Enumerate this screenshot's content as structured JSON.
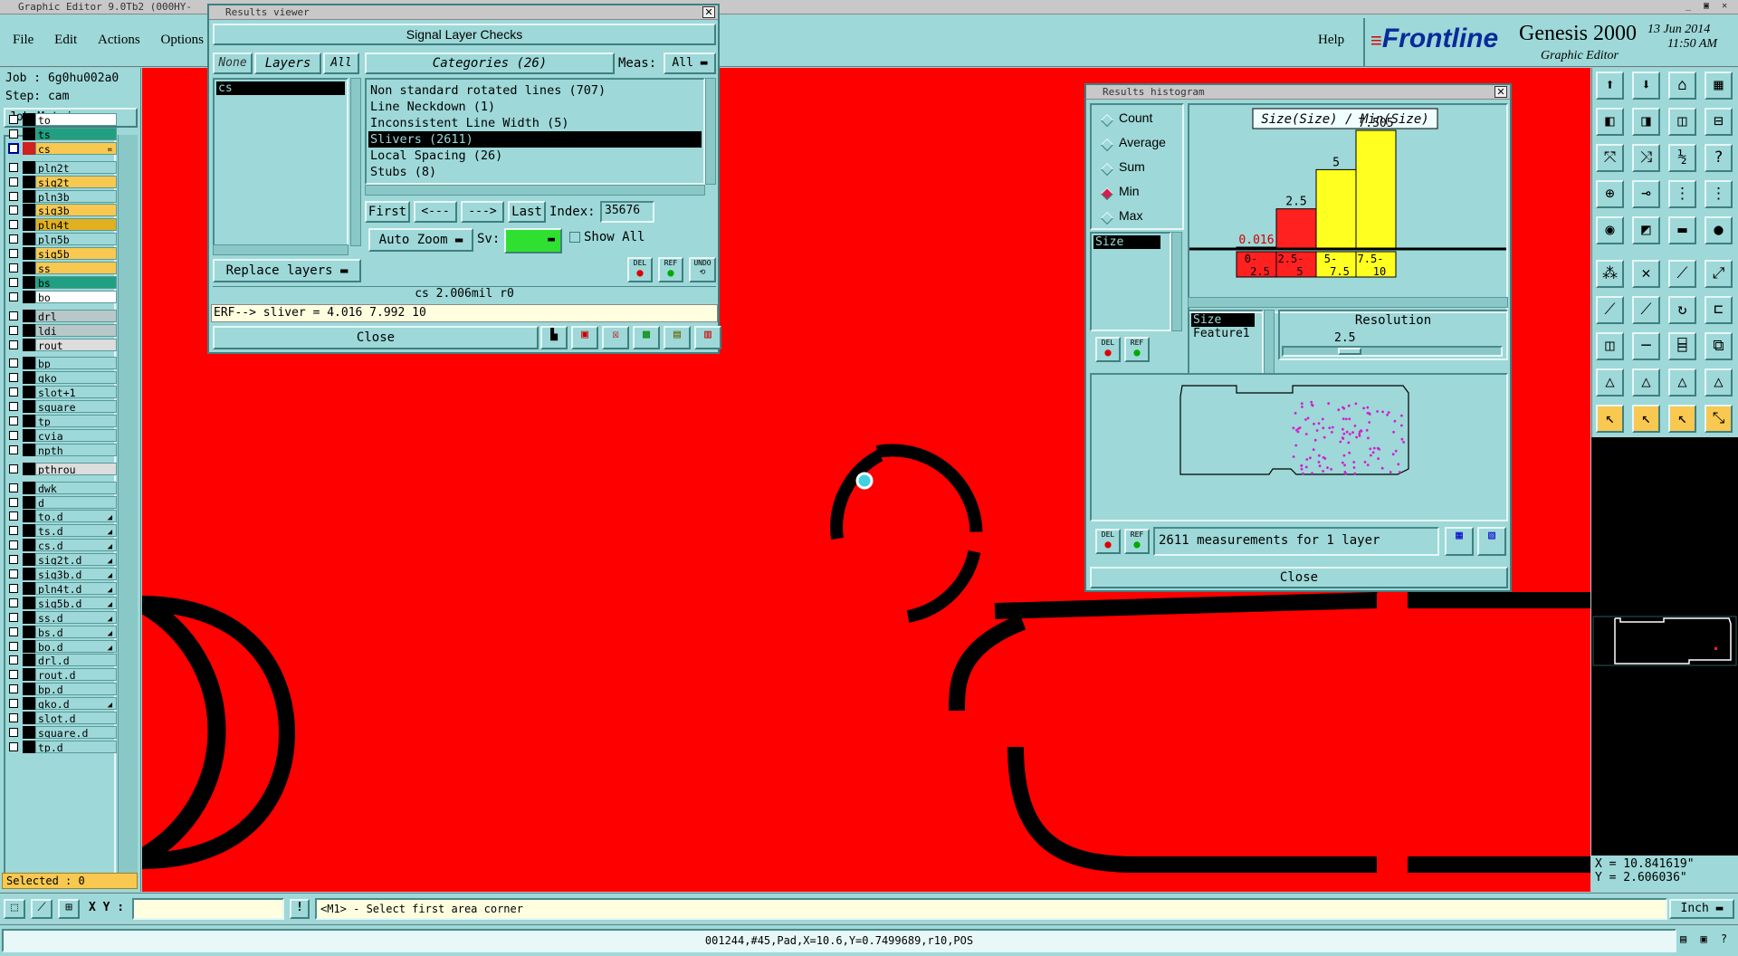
{
  "main_title": "Graphic Editor 9.0Tb2 (000HY-",
  "menu": [
    "File",
    "Edit",
    "Actions",
    "Options"
  ],
  "help_label": "Help",
  "brand": {
    "logo": "Frontline",
    "product": "Genesis 2000",
    "subtitle": "Graphic Editor",
    "date": "13 Jun 2014",
    "time": "11:50 AM"
  },
  "job": {
    "job_label": "Job : 6g0hu002a0",
    "step_label": "Step: cam",
    "matrix_button": "Job Matrix ..."
  },
  "layers": [
    {
      "name": "to",
      "color": "#ffffff",
      "active": false,
      "icon": ""
    },
    {
      "name": "ts",
      "color": "#20a080",
      "active": false,
      "icon": ""
    },
    {
      "name": "cs",
      "color": "#f8c850",
      "active": true,
      "icon": "="
    },
    {
      "name": "pln2t",
      "color": "#9ed8d8",
      "active": false,
      "icon": ""
    },
    {
      "name": "sig2t",
      "color": "#f8c850",
      "active": false,
      "icon": ""
    },
    {
      "name": "pln3b",
      "color": "#9ed8d8",
      "active": false,
      "icon": ""
    },
    {
      "name": "sig3b",
      "color": "#f8c850",
      "active": false,
      "icon": ""
    },
    {
      "name": "pln4t",
      "color": "#e0b020",
      "active": false,
      "icon": ""
    },
    {
      "name": "pln5b",
      "color": "#9ed8d8",
      "active": false,
      "icon": ""
    },
    {
      "name": "sig5b",
      "color": "#f8c850",
      "active": false,
      "icon": ""
    },
    {
      "name": "ss",
      "color": "#f8c850",
      "active": false,
      "icon": ""
    },
    {
      "name": "bs",
      "color": "#20a080",
      "active": false,
      "icon": ""
    },
    {
      "name": "bo",
      "color": "#ffffff",
      "active": false,
      "icon": ""
    },
    {
      "name": "drl",
      "color": "#b8c8c8",
      "active": false,
      "icon": ""
    },
    {
      "name": "ldi",
      "color": "#b8c8c8",
      "active": false,
      "icon": ""
    },
    {
      "name": "rout",
      "color": "#dddddd",
      "active": false,
      "icon": ""
    },
    {
      "name": "bp",
      "color": "#9ed8d8",
      "active": false,
      "icon": ""
    },
    {
      "name": "gko",
      "color": "#9ed8d8",
      "active": false,
      "icon": ""
    },
    {
      "name": "slot+1",
      "color": "#9ed8d8",
      "active": false,
      "icon": ""
    },
    {
      "name": "square",
      "color": "#9ed8d8",
      "active": false,
      "icon": ""
    },
    {
      "name": "tp",
      "color": "#9ed8d8",
      "active": false,
      "icon": ""
    },
    {
      "name": "cvia",
      "color": "#9ed8d8",
      "active": false,
      "icon": ""
    },
    {
      "name": "npth",
      "color": "#9ed8d8",
      "active": false,
      "icon": ""
    },
    {
      "name": "pthrou",
      "color": "#dddddd",
      "active": false,
      "icon": ""
    },
    {
      "name": "dwk",
      "color": "#9ed8d8",
      "active": false,
      "icon": ""
    },
    {
      "name": "d",
      "color": "#9ed8d8",
      "active": false,
      "icon": ""
    },
    {
      "name": "to.d",
      "color": "#9ed8d8",
      "active": false,
      "icon": "◢"
    },
    {
      "name": "ts.d",
      "color": "#9ed8d8",
      "active": false,
      "icon": "◢"
    },
    {
      "name": "cs.d",
      "color": "#9ed8d8",
      "active": false,
      "icon": "◢"
    },
    {
      "name": "sig2t.d",
      "color": "#9ed8d8",
      "active": false,
      "icon": "◢"
    },
    {
      "name": "sig3b.d",
      "color": "#9ed8d8",
      "active": false,
      "icon": "◢"
    },
    {
      "name": "pln4t.d",
      "color": "#9ed8d8",
      "active": false,
      "icon": "◢"
    },
    {
      "name": "sig5b.d",
      "color": "#9ed8d8",
      "active": false,
      "icon": "◢"
    },
    {
      "name": "ss.d",
      "color": "#9ed8d8",
      "active": false,
      "icon": "◢"
    },
    {
      "name": "bs.d",
      "color": "#9ed8d8",
      "active": false,
      "icon": "◢"
    },
    {
      "name": "bo.d",
      "color": "#9ed8d8",
      "active": false,
      "icon": "◢"
    },
    {
      "name": "drl.d",
      "color": "#9ed8d8",
      "active": false,
      "icon": ""
    },
    {
      "name": "rout.d",
      "color": "#9ed8d8",
      "active": false,
      "icon": ""
    },
    {
      "name": "bp.d",
      "color": "#9ed8d8",
      "active": false,
      "icon": ""
    },
    {
      "name": "gko.d",
      "color": "#9ed8d8",
      "active": false,
      "icon": "◢"
    },
    {
      "name": "slot.d",
      "color": "#9ed8d8",
      "active": false,
      "icon": ""
    },
    {
      "name": "square.d",
      "color": "#9ed8d8",
      "active": false,
      "icon": ""
    },
    {
      "name": "tp.d",
      "color": "#9ed8d8",
      "active": false,
      "icon": ""
    }
  ],
  "selected_label": "Selected : 0",
  "results_viewer": {
    "window_title": "Results viewer",
    "header": "Signal Layer Checks",
    "none_btn": "None",
    "layers_btn": "Layers",
    "all_btn": "All",
    "layer_items": [
      "cs"
    ],
    "categories_label": "Categories (26)",
    "meas_label": "Meas:",
    "meas_value": "All",
    "categories": [
      "Non standard rotated lines (707)",
      "Line Neckdown (1)",
      "Inconsistent Line Width (5)",
      "Slivers (2611)",
      "Local Spacing (26)",
      "Stubs (8)"
    ],
    "selected_category_index": 3,
    "first": "First",
    "prev": "<---",
    "next": "--->",
    "last": "Last",
    "index_label": "Index:",
    "index_value": "35676",
    "auto_zoom": "Auto Zoom",
    "sv_label": "Sv:",
    "show_all": "Show All",
    "replace_layers": "Replace layers",
    "del": "DEL",
    "ref": "REF",
    "undo": "UNDO",
    "status": "cs 2.006mil  r0",
    "erf": "ERF--> sliver = 4.016 7.992 10",
    "close": "Close"
  },
  "histogram": {
    "window_title": "Results histogram",
    "options": [
      "Count",
      "Average",
      "Sum",
      "Min",
      "Max"
    ],
    "selected_option": "Min",
    "field_list": [
      "Size"
    ],
    "chart_title": "Size(Size) / Min(Size)",
    "del": "DEL",
    "ref": "REF",
    "attr_list": [
      "Size",
      "Feature1"
    ],
    "resolution_label": "Resolution",
    "resolution_value": "2.5",
    "summary": "2611 measurements for 1 layer",
    "close": "Close"
  },
  "chart_data": {
    "type": "bar",
    "title": "Size(Size) / Min(Size)",
    "categories": [
      "0-2.5",
      "2.5-5",
      "5-7.5",
      "7.5-10"
    ],
    "values": [
      0.016,
      2.5,
      5,
      7.505
    ],
    "value_labels": [
      "0.016",
      "2.5",
      "5",
      "7.505"
    ],
    "bar_colors": [
      "#ff2020",
      "#ff2020",
      "#ffff20",
      "#ffff20"
    ],
    "ylim": [
      0,
      7.505
    ]
  },
  "coords": {
    "x": "X = 10.841619\"",
    "y": "Y = 2.606036\""
  },
  "bottom": {
    "xy_label": "X Y :",
    "xy_value": "",
    "prompt": "<M1> - Select first area corner",
    "units": "Inch"
  },
  "status_line": "001244,#45,Pad,X=10.6,Y=0.7499689,r10,POS"
}
